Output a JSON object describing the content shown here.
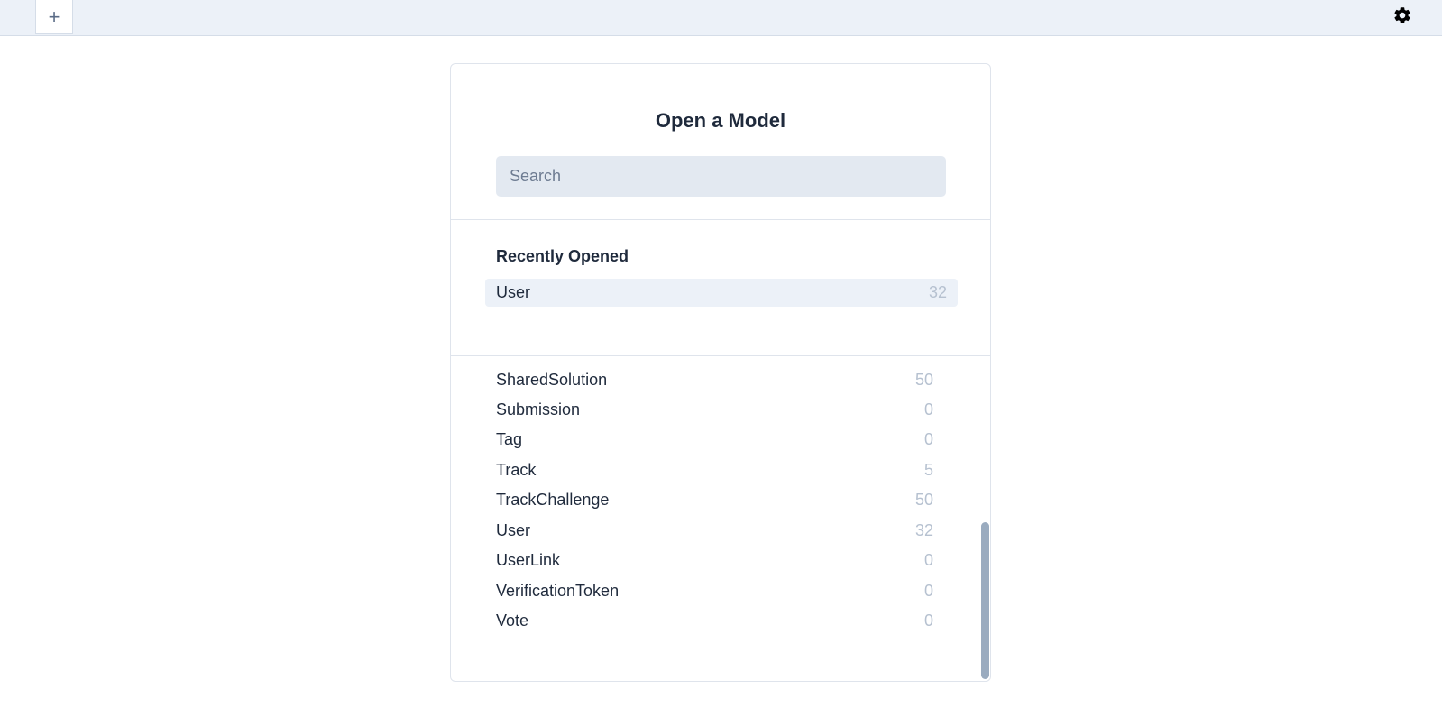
{
  "toolbar": {
    "add_tab_label": "+",
    "settings_icon": "gear-icon"
  },
  "panel": {
    "title": "Open a Model",
    "search_placeholder": "Search",
    "recent_title": "Recently Opened",
    "recent_items": [
      {
        "name": "User",
        "count": "32"
      }
    ],
    "models": [
      {
        "name": "SharedSolution",
        "count": "50"
      },
      {
        "name": "Submission",
        "count": "0"
      },
      {
        "name": "Tag",
        "count": "0"
      },
      {
        "name": "Track",
        "count": "5"
      },
      {
        "name": "TrackChallenge",
        "count": "50"
      },
      {
        "name": "User",
        "count": "32"
      },
      {
        "name": "UserLink",
        "count": "0"
      },
      {
        "name": "VerificationToken",
        "count": "0"
      },
      {
        "name": "Vote",
        "count": "0"
      }
    ]
  },
  "colors": {
    "topbar_bg": "#ecf1f8",
    "text": "#1f2a3c",
    "count": "#b6c1d0",
    "scrollbar": "#9aabbf"
  }
}
